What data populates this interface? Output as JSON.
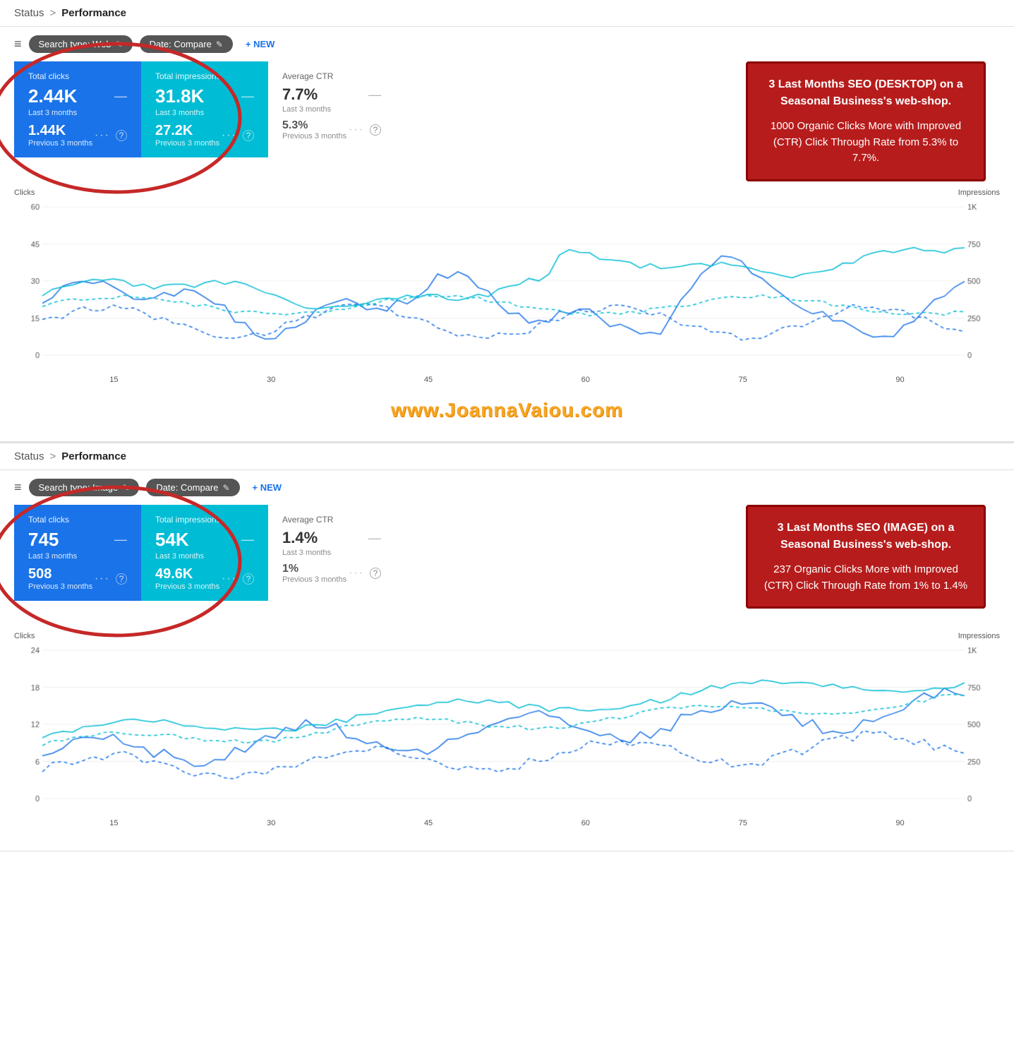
{
  "sections": [
    {
      "id": "desktop",
      "breadcrumb": {
        "status": "Status",
        "separator": ">",
        "current": "Performance"
      },
      "toolbar": {
        "filter_label": "≡",
        "chips": [
          {
            "label": "Search type: Web",
            "edit": "✎"
          },
          {
            "label": "Date: Compare",
            "edit": "✎"
          }
        ],
        "new_label": "+ NEW"
      },
      "metrics": [
        {
          "type": "blue",
          "label": "Total clicks",
          "current_value": "2.44K",
          "current_period": "Last 3 months",
          "prev_value": "1.44K",
          "prev_period": "Previous 3 months"
        },
        {
          "type": "teal",
          "label": "Total impressions",
          "current_value": "31.8K",
          "current_period": "Last 3 months",
          "prev_value": "27.2K",
          "prev_period": "Previous 3 months"
        },
        {
          "type": "plain",
          "label": "Average CTR",
          "current_value": "7.7%",
          "current_period": "Last 3 months",
          "prev_value": "5.3%",
          "prev_period": "Previous 3 months"
        }
      ],
      "annotation": {
        "title": "3 Last Months SEO (DESKTOP) on a Seasonal Business's web-shop.",
        "body": "1000 Organic Clicks More with Improved (CTR) Click Through Rate from 5.3% to 7.7%."
      },
      "chart": {
        "y_left_label": "Clicks",
        "y_right_label": "Impressions",
        "y_left_max": 60,
        "y_right_max": "1K",
        "x_ticks": [
          "15",
          "30",
          "45",
          "60",
          "75",
          "90"
        ]
      }
    },
    {
      "id": "image",
      "breadcrumb": {
        "status": "Status",
        "separator": ">",
        "current": "Performance"
      },
      "toolbar": {
        "filter_label": "≡",
        "chips": [
          {
            "label": "Search type: Image",
            "edit": "✎"
          },
          {
            "label": "Date: Compare",
            "edit": "✎"
          }
        ],
        "new_label": "+ NEW"
      },
      "metrics": [
        {
          "type": "blue",
          "label": "Total clicks",
          "current_value": "745",
          "current_period": "Last 3 months",
          "prev_value": "508",
          "prev_period": "Previous 3 months"
        },
        {
          "type": "teal",
          "label": "Total impressions",
          "current_value": "54K",
          "current_period": "Last 3 months",
          "prev_value": "49.6K",
          "prev_period": "Previous 3 months"
        },
        {
          "type": "plain",
          "label": "Average CTR",
          "current_value": "1.4%",
          "current_period": "Last 3 months",
          "prev_value": "1%",
          "prev_period": "Previous 3 months"
        }
      ],
      "annotation": {
        "title": "3 Last Months SEO (IMAGE) on a Seasonal Business's web-shop.",
        "body": "237 Organic Clicks More with Improved (CTR) Click Through Rate from 1% to 1.4%"
      },
      "chart": {
        "y_left_label": "Clicks",
        "y_right_label": "Impressions",
        "y_left_max": 24,
        "y_right_max": "1K",
        "x_ticks": [
          "15",
          "30",
          "45",
          "60",
          "75",
          "90"
        ]
      }
    }
  ],
  "watermark": "www.JoannaVaiou.com"
}
